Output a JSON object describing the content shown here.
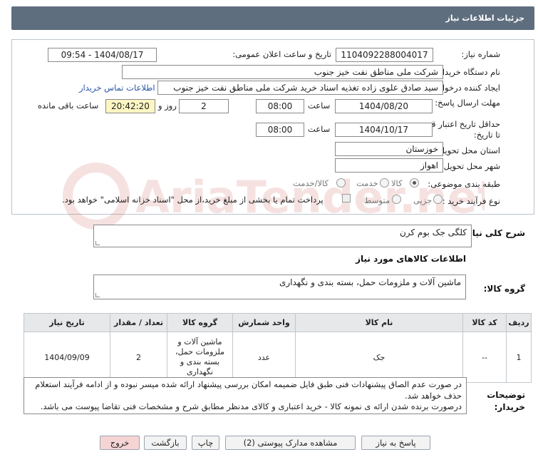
{
  "header": {
    "title": "جزئیات اطلاعات نیاز"
  },
  "fields": {
    "need_number": {
      "label": "شماره نیاز:",
      "value": "1104092288004017"
    },
    "announce_date": {
      "label": "تاریخ و ساعت اعلان عمومی:",
      "value": "1404/08/17 - 09:54"
    },
    "buyer_org": {
      "label": "نام دستگاه خریدار:",
      "value": "شرکت ملی مناطق نفت خیز جنوب"
    },
    "requester": {
      "label": "ایجاد کننده درخواست:",
      "value": "سید صادق علوی زاده  تغذیه اسناد خرید  شرکت ملی مناطق نفت خیز جنوب",
      "contact_link": "اطلاعات تماس خریدار"
    },
    "reply_deadline": {
      "label": "مهلت ارسال پاسخ: تا تاریخ:",
      "date": "1404/08/20",
      "time_label": "ساعت",
      "time": "08:00",
      "days": "2",
      "days_label": "روز و",
      "remaining": "20:42:20",
      "remaining_label": "ساعت باقی مانده"
    },
    "price_validity": {
      "label": "حداقل تاریخ اعتبار قیمت: تا تاریخ:",
      "date": "1404/10/17",
      "time_label": "ساعت",
      "time": "08:00"
    },
    "province": {
      "label": "استان محل تحویل:",
      "value": "خوزستان"
    },
    "city": {
      "label": "شهر محل تحویل:",
      "value": "اهواز"
    },
    "category": {
      "label": "طبقه بندی موضوعی:",
      "options": [
        "کالا",
        "خدمت",
        "کالا/خدمت"
      ],
      "selected": "کالا"
    },
    "process_type": {
      "label": "نوع فرآیند خرید :",
      "options": [
        "جزیی",
        "متوسط"
      ],
      "checkbox_text": "پرداخت تمام یا بخشی از مبلغ خرید،از محل \"اسناد خزانه اسلامی\" خواهد بود."
    }
  },
  "summary": {
    "label": "شرح کلی نیاز:",
    "value": "کلگی جک بوم کرن"
  },
  "goods_info": {
    "title": "اطلاعات کالاهای مورد نیاز"
  },
  "goods_group": {
    "label": "گروه کالا:",
    "value": "ماشین آلات و ملزومات حمل، بسته بندی و نگهداری"
  },
  "table": {
    "headers": [
      "ردیف",
      "کد کالا",
      "نام کالا",
      "واحد شمارش",
      "گروه کالا",
      "تعداد / مقدار",
      "تاریخ نیاز"
    ],
    "rows": [
      {
        "row": "1",
        "code": "--",
        "name": "جک",
        "unit": "عدد",
        "group": "ماشین آلات و ملزومات حمل، بسته بندی و نگهداری",
        "qty": "2",
        "date": "1404/09/09"
      }
    ]
  },
  "notes": {
    "label": "توضیحات خریدار:",
    "lines": [
      "در صورت عدم الصاق پیشنهادات فنی طبق فایل ضمیمه امکان بررسی پیشنهاد ارائه شده میسر نبوده و از ادامه فرآیند استعلام حذف خواهد شد.",
      "درصورت برنده شدن ارائه ی نمونه کالا - خرید اعتباری و کالای مدنظر مطابق شرح و مشخصات فنی تقاضا پیوست می باشد."
    ]
  },
  "buttons": {
    "reply": "پاسخ به نیاز",
    "attachments": "مشاهده مدارک پیوستی (2)",
    "print": "چاپ",
    "back": "بازگشت",
    "exit": "خروج"
  },
  "watermark": {
    "text": "AriaTender.net"
  }
}
